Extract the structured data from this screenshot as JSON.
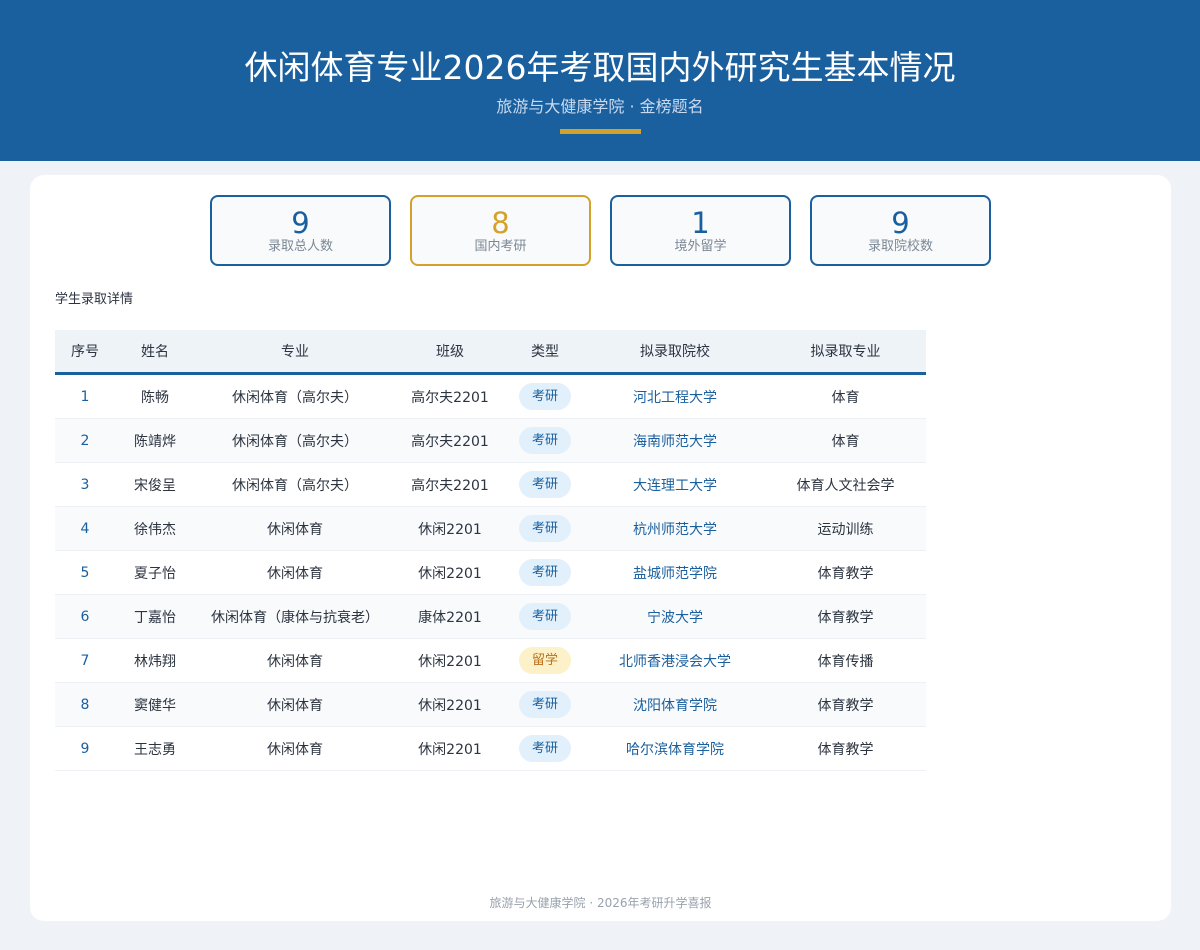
{
  "header": {
    "title": "休闲体育专业2026年考取国内外研究生基本情况",
    "subtitle": "旅游与大健康学院 · 金榜题名"
  },
  "stats": [
    {
      "value": "9",
      "label": "录取总人数"
    },
    {
      "value": "8",
      "label": "国内考研"
    },
    {
      "value": "1",
      "label": "境外留学"
    },
    {
      "value": "9",
      "label": "录取院校数"
    }
  ],
  "section_label": "学生录取详情",
  "table": {
    "headers": [
      "序号",
      "姓名",
      "专业",
      "班级",
      "类型",
      "拟录取院校",
      "拟录取专业"
    ],
    "rows": [
      {
        "idx": "1",
        "name": "陈畅",
        "major": "休闲体育（高尔夫）",
        "class": "高尔夫2201",
        "type": "考研",
        "type_kind": "kaoyan",
        "school": "河北工程大学",
        "target": "体育"
      },
      {
        "idx": "2",
        "name": "陈靖烨",
        "major": "休闲体育（高尔夫）",
        "class": "高尔夫2201",
        "type": "考研",
        "type_kind": "kaoyan",
        "school": "海南师范大学",
        "target": "体育"
      },
      {
        "idx": "3",
        "name": "宋俊呈",
        "major": "休闲体育（高尔夫）",
        "class": "高尔夫2201",
        "type": "考研",
        "type_kind": "kaoyan",
        "school": "大连理工大学",
        "target": "体育人文社会学"
      },
      {
        "idx": "4",
        "name": "徐伟杰",
        "major": "休闲体育",
        "class": "休闲2201",
        "type": "考研",
        "type_kind": "kaoyan",
        "school": "杭州师范大学",
        "target": "运动训练"
      },
      {
        "idx": "5",
        "name": "夏子怡",
        "major": "休闲体育",
        "class": "休闲2201",
        "type": "考研",
        "type_kind": "kaoyan",
        "school": "盐城师范学院",
        "target": "体育教学"
      },
      {
        "idx": "6",
        "name": "丁嘉怡",
        "major": "休闲体育（康体与抗衰老）",
        "class": "康体2201",
        "type": "考研",
        "type_kind": "kaoyan",
        "school": "宁波大学",
        "target": "体育教学"
      },
      {
        "idx": "7",
        "name": "林炜翔",
        "major": "休闲体育",
        "class": "休闲2201",
        "type": "留学",
        "type_kind": "liuxue",
        "school": "北师香港浸会大学",
        "target": "体育传播"
      },
      {
        "idx": "8",
        "name": "窦健华",
        "major": "休闲体育",
        "class": "休闲2201",
        "type": "考研",
        "type_kind": "kaoyan",
        "school": "沈阳体育学院",
        "target": "体育教学"
      },
      {
        "idx": "9",
        "name": "王志勇",
        "major": "休闲体育",
        "class": "休闲2201",
        "type": "考研",
        "type_kind": "kaoyan",
        "school": "哈尔滨体育学院",
        "target": "体育教学"
      }
    ]
  },
  "footer": "旅游与大健康学院 · 2026年考研升学喜报",
  "colors": {
    "primary": "#1a5f9e",
    "accent": "#d4a22a",
    "background": "#eff3f8"
  }
}
